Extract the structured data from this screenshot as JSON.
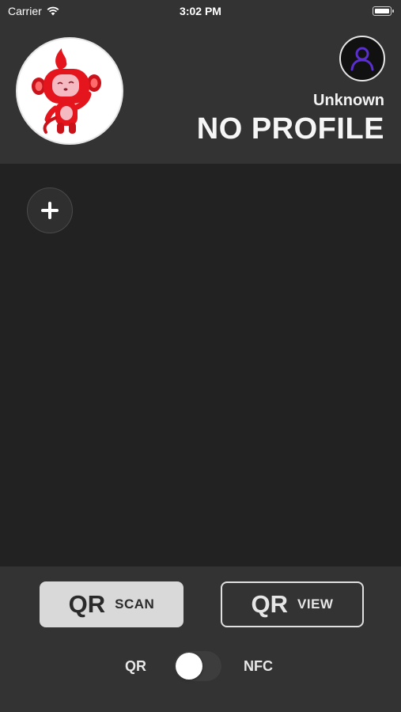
{
  "status_bar": {
    "carrier": "Carrier",
    "time": "3:02 PM"
  },
  "profile": {
    "name": "Unknown",
    "title": "NO PROFILE"
  },
  "footer": {
    "scan_button": {
      "big": "QR",
      "small": "SCAN"
    },
    "view_button": {
      "big": "QR",
      "small": "VIEW"
    },
    "toggle": {
      "left_label": "QR",
      "right_label": "NFC",
      "state": "QR"
    }
  },
  "colors": {
    "header_bg": "#333333",
    "content_bg": "#222222",
    "mascot_red": "#e4151c",
    "profile_icon": "#5a2fd0"
  },
  "icons": {
    "mascot": "red-monkey-mascot-icon",
    "profile": "person-icon",
    "add": "plus-icon",
    "wifi": "wifi-icon",
    "battery": "battery-icon"
  }
}
